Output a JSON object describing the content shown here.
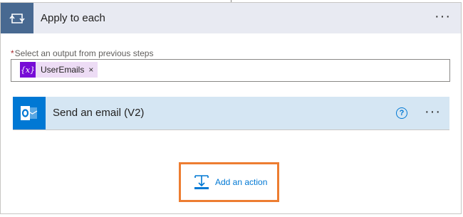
{
  "loop": {
    "title": "Apply to each",
    "menu": "···",
    "field": {
      "required_mark": "*",
      "label": "Select an output from previous steps",
      "token": {
        "icon_text": "{x}",
        "label": "UserEmails",
        "remove": "×"
      }
    }
  },
  "action": {
    "title": "Send an email (V2)",
    "help": "?",
    "menu": "···"
  },
  "add_action": {
    "label": "Add an action"
  },
  "colors": {
    "loop_icon_bg": "#486991",
    "header_bg": "#e8eaf2",
    "action_bg": "#d5e6f3",
    "outlook_bg": "#0078d4",
    "token_bg": "#eddcf5",
    "token_icon_bg": "#770bd6",
    "highlight": "#ed7d31",
    "link": "#0078d4"
  }
}
